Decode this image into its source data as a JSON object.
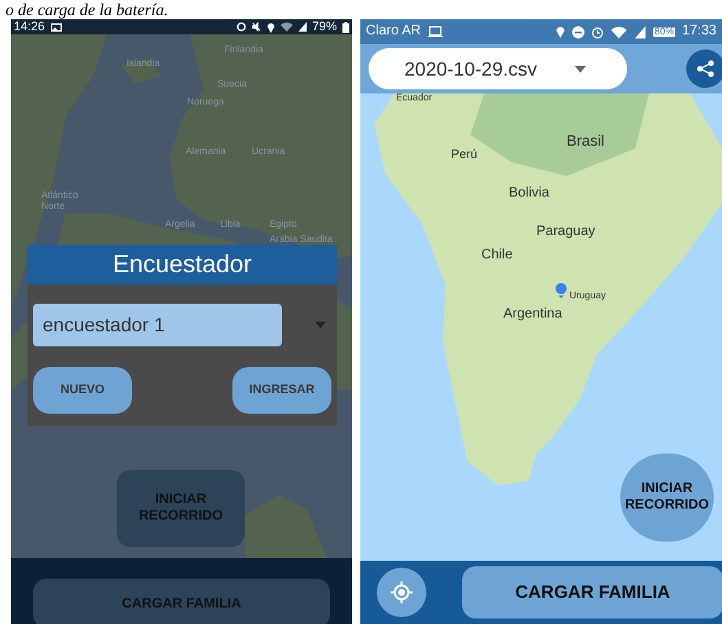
{
  "caption": "o de carga de la batería.",
  "left_phone": {
    "status_bar": {
      "time": "14:26",
      "battery": "79%"
    },
    "map_labels": [
      "Islandia",
      "Finlandia",
      "Suecia",
      "Noruega",
      "Atlántico Norte",
      "Alemania",
      "Ucrania",
      "Argelia",
      "Libia",
      "Egipto",
      "Arabia Saudita"
    ],
    "dialog": {
      "title": "Encuestador",
      "selected_value": "encuestador 1",
      "buttons": [
        "NUEVO",
        "INGRESAR"
      ]
    },
    "start_button": "INICIAR RECORRIDO",
    "load_button": "CARGAR FAMILIA"
  },
  "right_phone": {
    "status_bar": {
      "carrier": "Claro AR",
      "battery": "80%",
      "time": "17:33"
    },
    "file_dropdown": "2020-10-29.csv",
    "map_labels": [
      "Ecuador",
      "Perú",
      "Brasil",
      "Bolivia",
      "Paraguay",
      "Chile",
      "Uruguay",
      "Argentina"
    ],
    "start_button": "INICIAR RECORRIDO",
    "load_button": "CARGAR FAMILIA"
  }
}
